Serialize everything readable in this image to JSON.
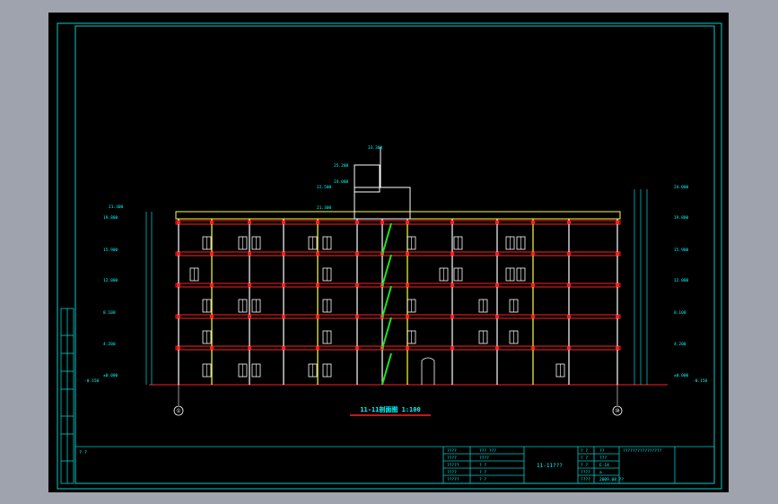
{
  "drawing": {
    "title": "11-11剖面图 1:100",
    "axis_left": "①",
    "axis_right": "⑩"
  },
  "elevations_left": [
    "21.300",
    "19.800",
    "15.900",
    "12.000",
    "8.100",
    "4.200",
    "±0.000",
    "-0.150"
  ],
  "elevations_right": [
    "24.000",
    "19.800",
    "15.900",
    "12.000",
    "8.100",
    "4.200",
    "±0.000",
    "-0.150"
  ],
  "elevations_top": [
    "33.300",
    "25.200",
    "24.000",
    "22.500",
    "21.300"
  ],
  "title_block": {
    "left_note": "? ?",
    "mid_labels": [
      "????",
      "????",
      "?????",
      "????",
      "?????"
    ],
    "mid_values": [
      "??? ???",
      "????",
      "? ?",
      "? ?",
      "? ?"
    ],
    "drawing_name": "11-11???",
    "info_labels": [
      "? ?",
      "? ?",
      "? ?",
      "????",
      "????"
    ],
    "info_values": [
      "??",
      "???",
      "E-14",
      "a",
      "2009.08.??"
    ],
    "company": "????????????????"
  },
  "colors": {
    "border": "#00cccc",
    "beam": "#ff2020",
    "column": "#ffff40",
    "green": "#20e020",
    "white": "#ffffff",
    "cyan": "#00ffff"
  }
}
